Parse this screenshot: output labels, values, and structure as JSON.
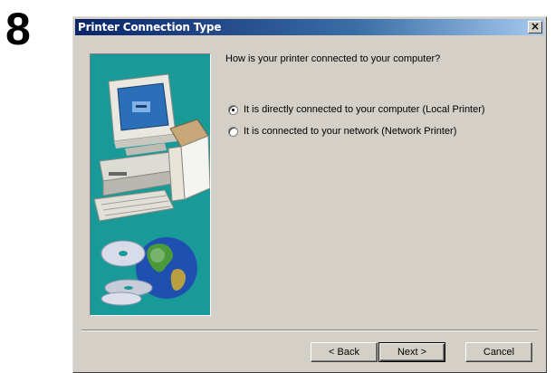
{
  "step": "8",
  "dialog": {
    "title": "Printer Connection Type",
    "close_glyph": "×",
    "question": "How is your printer connected to your computer?",
    "options": [
      {
        "label": "It is directly connected to your computer (Local Printer)",
        "selected": true
      },
      {
        "label": "It is connected to your network (Network Printer)",
        "selected": false
      }
    ],
    "buttons": {
      "back": "< Back",
      "next": "Next >",
      "cancel": "Cancel"
    }
  },
  "colors": {
    "title_bar_start": "#0a246a",
    "title_bar_end": "#a6caf0",
    "panel_bg": "#d4d0c8",
    "art_bg": "#1a9999"
  },
  "icons": [
    "computer-illustration",
    "globe-icon",
    "cd-disc-icon",
    "close-icon"
  ]
}
